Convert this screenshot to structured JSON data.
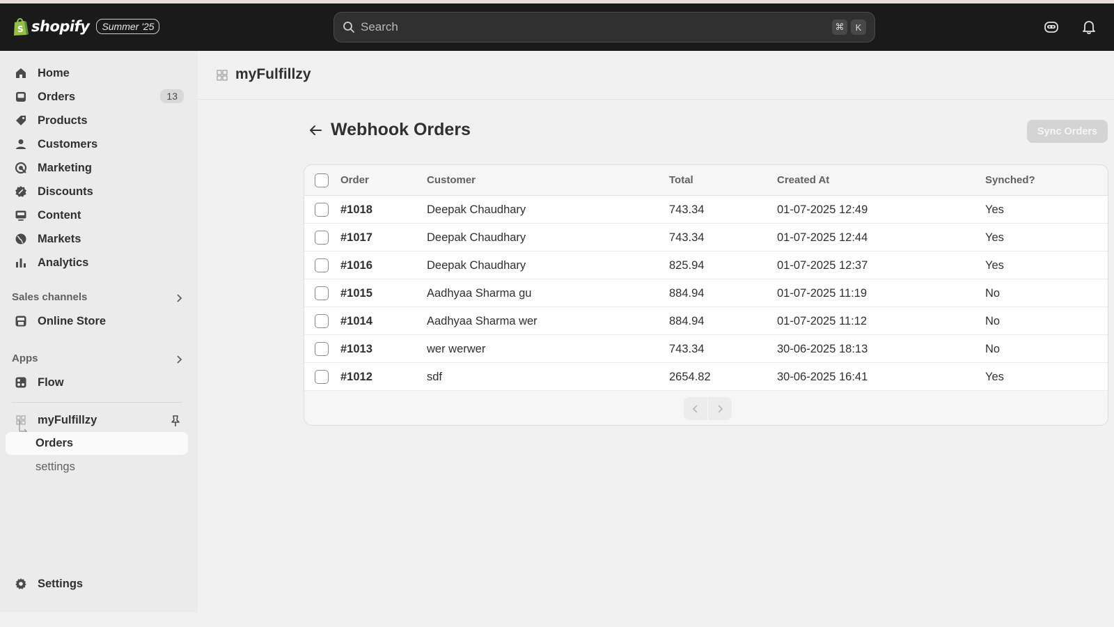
{
  "topbar": {
    "brand": "shopify",
    "edition": "Summer '25",
    "search_placeholder": "Search",
    "shortcut_keys": [
      "⌘",
      "K"
    ],
    "icons": [
      "sidekick-icon",
      "bell-icon"
    ]
  },
  "sidebar": {
    "items": [
      {
        "label": "Home",
        "icon": "home-icon"
      },
      {
        "label": "Orders",
        "icon": "orders-icon",
        "badge": "13"
      },
      {
        "label": "Products",
        "icon": "tag-icon"
      },
      {
        "label": "Customers",
        "icon": "person-icon"
      },
      {
        "label": "Marketing",
        "icon": "target-icon"
      },
      {
        "label": "Discounts",
        "icon": "discount-icon"
      },
      {
        "label": "Content",
        "icon": "content-icon"
      },
      {
        "label": "Markets",
        "icon": "globe-icon"
      },
      {
        "label": "Analytics",
        "icon": "chart-icon"
      }
    ],
    "sales_channels_label": "Sales channels",
    "online_store_label": "Online Store",
    "apps_label": "Apps",
    "flow_label": "Flow",
    "app_name": "myFulfillzy",
    "app_sub_items": [
      "Orders",
      "settings"
    ],
    "settings_label": "Settings"
  },
  "main": {
    "app_title": "myFulfillzy",
    "page_title": "Webhook Orders",
    "sync_button": "Sync Orders",
    "table": {
      "headers": [
        "Order",
        "Customer",
        "Total",
        "Created At",
        "Synched?"
      ],
      "rows": [
        {
          "order": "#1018",
          "customer": "Deepak Chaudhary",
          "total": "743.34",
          "created": "01-07-2025 12:49",
          "synched": "Yes"
        },
        {
          "order": "#1017",
          "customer": "Deepak Chaudhary",
          "total": "743.34",
          "created": "01-07-2025 12:44",
          "synched": "Yes"
        },
        {
          "order": "#1016",
          "customer": "Deepak Chaudhary",
          "total": "825.94",
          "created": "01-07-2025 12:37",
          "synched": "Yes"
        },
        {
          "order": "#1015",
          "customer": "Aadhyaa Sharma gu",
          "total": "884.94",
          "created": "01-07-2025 11:19",
          "synched": "No"
        },
        {
          "order": "#1014",
          "customer": "Aadhyaa Sharma wer",
          "total": "884.94",
          "created": "01-07-2025 11:12",
          "synched": "No"
        },
        {
          "order": "#1013",
          "customer": "wer werwer",
          "total": "743.34",
          "created": "30-06-2025 18:13",
          "synched": "No"
        },
        {
          "order": "#1012",
          "customer": "sdf",
          "total": "2654.82",
          "created": "30-06-2025 16:41",
          "synched": "Yes"
        }
      ]
    }
  },
  "colors": {
    "topbar_bg": "#1a1a1a",
    "sidebar_bg": "#ebebeb",
    "page_bg": "#f1f1f1",
    "brand_accent": "#95bf47"
  }
}
